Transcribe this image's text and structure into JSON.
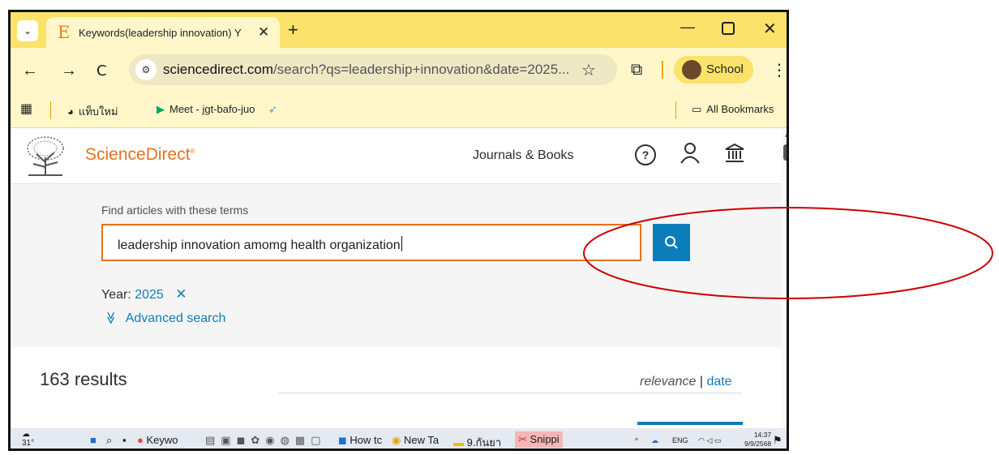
{
  "browser": {
    "tab_dropdown_icon": "⌄",
    "tab": {
      "favicon": "E",
      "title": "Keywords(leadership innovation) Y",
      "close_icon": "✕"
    },
    "new_tab_icon": "+",
    "window": {
      "minimize_icon": "—",
      "close_icon": "✕"
    },
    "nav": {
      "back_icon": "←",
      "forward_icon": "→",
      "reload_icon": "C"
    },
    "url": {
      "host": "sciencedirect.com",
      "path": "/search?qs=leadership+innovation&date=2025..."
    },
    "star_icon": "☆",
    "extensions_icon": "⧉",
    "profile": {
      "name": "School"
    },
    "menu_icon": "⋮"
  },
  "bookmarks": {
    "apps_icon": "▦",
    "items": [
      {
        "label": "แท็บใหม่"
      },
      {
        "label": "Meet - jgt-bafo-juo"
      }
    ],
    "all_label": "All Bookmarks"
  },
  "sciencedirect": {
    "logo_text": "ScienceDirect",
    "logo_mark": "®",
    "nav_journals": "Journals & Books",
    "help_icon": "?",
    "user_icon": "person",
    "institution_icon": "🏛"
  },
  "search": {
    "label": "Find articles with these terms",
    "query": "leadership innovation amomg health organization",
    "filter_year_label": "Year:",
    "filter_year_value": "2025",
    "filter_remove_icon": "✕",
    "advanced_icon": "≫",
    "advanced_label": "Advanced search"
  },
  "results": {
    "count_text": "163 results",
    "sort_relevance": "relevance",
    "sort_separator": "|",
    "sort_date": "date"
  },
  "taskbar": {
    "weather": "31°",
    "apps": [
      {
        "label": "Keywo"
      },
      {
        "label": "How tc"
      },
      {
        "label": "New Ta"
      },
      {
        "label": "9.กันยา"
      },
      {
        "label": "Snippi"
      }
    ],
    "tray": {
      "lang": "ENG"
    },
    "clock": {
      "time": "14:37",
      "date": "9/9/2568"
    }
  },
  "colors": {
    "tab_bar": "#fbe26a",
    "toolbar": "#fff7c9",
    "brand_orange": "#e9711c",
    "link_blue": "#0c7dbb",
    "annotation_red": "#cc0000"
  }
}
